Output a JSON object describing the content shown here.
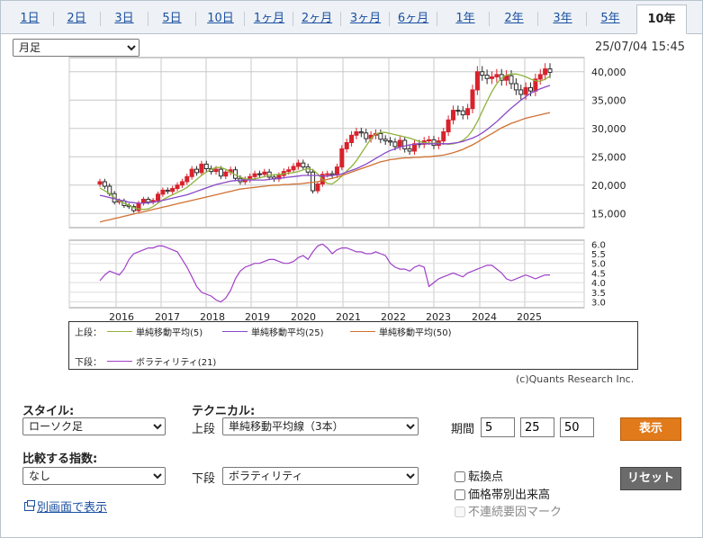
{
  "tabs": [
    {
      "label": "1日",
      "active": false
    },
    {
      "label": "2日",
      "active": false
    },
    {
      "label": "3日",
      "active": false
    },
    {
      "label": "5日",
      "active": false
    },
    {
      "label": "10日",
      "active": false
    },
    {
      "label": "1ヶ月",
      "active": false
    },
    {
      "label": "2ヶ月",
      "active": false
    },
    {
      "label": "3ヶ月",
      "active": false
    },
    {
      "label": "6ヶ月",
      "active": false
    },
    {
      "label": "1年",
      "active": false
    },
    {
      "label": "2年",
      "active": false
    },
    {
      "label": "3年",
      "active": false
    },
    {
      "label": "5年",
      "active": false
    },
    {
      "label": "10年",
      "active": true
    }
  ],
  "period_select": {
    "value": "月足"
  },
  "timestamp": "25/07/04 15:45",
  "chart_data": [
    {
      "type": "candlestick",
      "x_ticks": [
        "2016",
        "2017",
        "2018",
        "2019",
        "2020",
        "2021",
        "2022",
        "2023",
        "2024",
        "2025"
      ],
      "y_ticks": [
        "40,000",
        "35,000",
        "30,000",
        "25,000",
        "20,000",
        "15,000"
      ],
      "ylim": [
        12500,
        42500
      ],
      "grid": true,
      "series": [
        {
          "name": "単純移動平均(5)",
          "color": "#8fb33a",
          "values": [
            19500,
            19000,
            18500,
            17800,
            17200,
            16800,
            16400,
            16000,
            15800,
            15700,
            15800,
            16200,
            16800,
            17400,
            17900,
            18300,
            18700,
            19100,
            19600,
            20300,
            21000,
            21700,
            22300,
            22800,
            23100,
            23100,
            22800,
            22300,
            21800,
            21400,
            21100,
            21000,
            21100,
            21300,
            21500,
            21700,
            21800,
            21900,
            22000,
            22100,
            22200,
            22400,
            22700,
            22900,
            22700,
            22000,
            21000,
            20300,
            20200,
            20800,
            21600,
            22500,
            23300,
            24300,
            25600,
            26900,
            28200,
            29000,
            29300,
            29300,
            29100,
            28900,
            28700,
            28500,
            28300,
            28000,
            27700,
            27500,
            27400,
            27400,
            27400,
            27300,
            27200,
            27300,
            27500,
            27900,
            28600,
            29700,
            31200,
            33000,
            34800,
            36500,
            37900,
            38900,
            39400,
            39600,
            39600,
            39400,
            39100,
            38700,
            38400,
            38300,
            38700,
            39200
          ]
        },
        {
          "name": "単純移動平均(25)",
          "color": "#8a48c8",
          "values": [
            18200,
            18000,
            17800,
            17600,
            17400,
            17200,
            17000,
            16900,
            16800,
            16800,
            16900,
            17000,
            17100,
            17300,
            17500,
            17700,
            17900,
            18100,
            18300,
            18600,
            18900,
            19200,
            19500,
            19800,
            20100,
            20300,
            20500,
            20700,
            20800,
            20900,
            20900,
            20900,
            20900,
            20900,
            20900,
            21000,
            21100,
            21200,
            21300,
            21400,
            21500,
            21600,
            21700,
            21700,
            21700,
            21700,
            21600,
            21600,
            21700,
            21800,
            22000,
            22300,
            22600,
            22900,
            23300,
            23700,
            24200,
            24700,
            25200,
            25700,
            26100,
            26400,
            26700,
            26900,
            27100,
            27200,
            27300,
            27300,
            27300,
            27300,
            27300,
            27300,
            27300,
            27400,
            27500,
            27700,
            28000,
            28300,
            28700,
            29200,
            29800,
            30500,
            31200,
            32000,
            32800,
            33600,
            34300,
            35000,
            35600,
            36200,
            36600,
            37000,
            37300,
            37600
          ]
        },
        {
          "name": "単純移動平均(50)",
          "color": "#d07030",
          "values": [
            13500,
            13700,
            13900,
            14100,
            14300,
            14500,
            14700,
            14900,
            15100,
            15300,
            15500,
            15700,
            15900,
            16100,
            16300,
            16500,
            16700,
            16900,
            17100,
            17300,
            17500,
            17700,
            17900,
            18100,
            18300,
            18500,
            18700,
            18900,
            19100,
            19300,
            19400,
            19500,
            19600,
            19700,
            19800,
            19900,
            20000,
            20000,
            20100,
            20100,
            20200,
            20200,
            20300,
            20400,
            20500,
            20600,
            20800,
            21000,
            21200,
            21400,
            21700,
            22000,
            22300,
            22600,
            22900,
            23200,
            23500,
            23800,
            24100,
            24300,
            24500,
            24600,
            24700,
            24800,
            24800,
            24900,
            24900,
            25000,
            25000,
            25100,
            25200,
            25300,
            25500,
            25700,
            26000,
            26300,
            26700,
            27100,
            27600,
            28100,
            28600,
            29100,
            29600,
            30100,
            30500,
            30900,
            31200,
            31500,
            31800,
            32000,
            32200,
            32400,
            32600,
            32800
          ]
        }
      ],
      "candles_close": [
        20600,
        19800,
        18500,
        17000,
        17200,
        16400,
        16200,
        15500,
        16800,
        17500,
        17000,
        17300,
        18400,
        19100,
        18900,
        19400,
        20000,
        20600,
        21500,
        22800,
        22200,
        23700,
        22900,
        22400,
        22800,
        21600,
        22300,
        22700,
        21200,
        20600,
        21000,
        21500,
        22000,
        21900,
        22300,
        21400,
        21100,
        21700,
        22400,
        22700,
        23300,
        23900,
        23200,
        22300,
        19000,
        20200,
        21900,
        22000,
        21800,
        23200,
        26400,
        27500,
        28800,
        29400,
        29200,
        28200,
        28800,
        29100,
        28100,
        27800,
        27600,
        26800,
        27900,
        26400,
        26000,
        27300,
        27200,
        27800,
        28000,
        27000,
        27800,
        29400,
        31500,
        33200,
        33100,
        32400,
        33500,
        36800,
        40000,
        39400,
        38800,
        39100,
        39500,
        38500,
        39300,
        37900,
        36800,
        36000,
        37200,
        36600,
        38700,
        39500,
        40500,
        39900
      ]
    },
    {
      "type": "line",
      "x_ticks": [
        "2016",
        "2017",
        "2018",
        "2019",
        "2020",
        "2021",
        "2022",
        "2023",
        "2024",
        "2025"
      ],
      "y_ticks": [
        "6.0",
        "5.5",
        "5.0",
        "4.5",
        "4.0",
        "3.5",
        "3.0"
      ],
      "ylim": [
        2.7,
        6.2
      ],
      "series": [
        {
          "name": "ボラティリティ(21)",
          "color": "#a040c8",
          "values": [
            4.1,
            4.4,
            4.6,
            4.5,
            4.4,
            4.7,
            5.2,
            5.5,
            5.6,
            5.7,
            5.8,
            5.8,
            5.9,
            5.9,
            5.8,
            5.7,
            5.6,
            5.2,
            4.8,
            4.3,
            3.8,
            3.5,
            3.4,
            3.3,
            3.1,
            3.0,
            3.2,
            3.6,
            4.2,
            4.6,
            4.8,
            4.9,
            5.0,
            5.0,
            5.1,
            5.2,
            5.2,
            5.1,
            5.0,
            5.0,
            5.1,
            5.3,
            5.4,
            5.2,
            5.6,
            5.9,
            6.0,
            5.8,
            5.5,
            5.7,
            5.8,
            5.8,
            5.7,
            5.6,
            5.6,
            5.5,
            5.5,
            5.6,
            5.5,
            5.4,
            5.0,
            4.8,
            4.7,
            4.7,
            4.6,
            4.8,
            4.9,
            4.8,
            3.8,
            4.0,
            4.2,
            4.3,
            4.4,
            4.5,
            4.4,
            4.3,
            4.5,
            4.6,
            4.7,
            4.8,
            4.9,
            4.9,
            4.7,
            4.5,
            4.2,
            4.1,
            4.2,
            4.3,
            4.4,
            4.3,
            4.2,
            4.3,
            4.4,
            4.4
          ]
        }
      ]
    }
  ],
  "legend": {
    "upper_label": "上段：",
    "lower_label": "下段：",
    "upper_items": [
      "単純移動平均(5)",
      "単純移動平均(25)",
      "単純移動平均(50)"
    ],
    "lower_items": [
      "ボラティリティ(21)"
    ]
  },
  "copyright": "(c)Quants Research Inc.",
  "controls": {
    "style_label": "スタイル:",
    "style_value": "ローソク足",
    "technical_label": "テクニカル:",
    "upper_label": "上段",
    "upper_value": "単純移動平均線（3本）",
    "period_label": "期間",
    "period_values": [
      "5",
      "25",
      "50"
    ],
    "display_button": "表示",
    "compare_label": "比較する指数:",
    "compare_value": "なし",
    "lower_label": "下段",
    "lower_value": "ボラティリティ",
    "reset_button": "リセット",
    "open_window_link": "別画面で表示",
    "checkboxes": [
      {
        "label": "転換点",
        "checked": false,
        "disabled": false
      },
      {
        "label": "価格帯別出来高",
        "checked": false,
        "disabled": false
      },
      {
        "label": "不連続要因マーク",
        "checked": false,
        "disabled": true
      }
    ],
    "colors": {
      "display_button": "#e07a1a",
      "reset_button": "#6b6b6b"
    }
  }
}
